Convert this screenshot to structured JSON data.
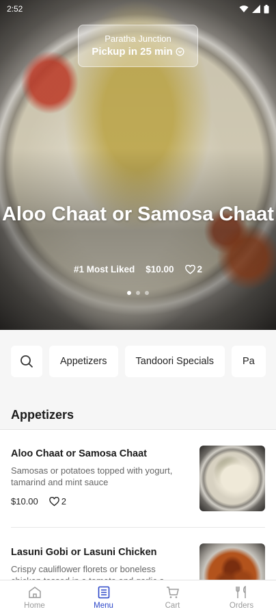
{
  "status_bar": {
    "time": "2:52"
  },
  "hero": {
    "store_name": "Paratha Junction",
    "pickup_text": "Pickup in 25 min",
    "title": "Aloo Chaat or Samosa Chaat",
    "badge": "#1 Most Liked",
    "price": "$10.00",
    "likes": "2",
    "carousel_pages": 3,
    "carousel_active": 1
  },
  "categories": [
    "Appetizers",
    "Tandoori Specials",
    "Pa"
  ],
  "section": {
    "title": "Appetizers"
  },
  "items": [
    {
      "name": "Aloo Chaat or Samosa Chaat",
      "description": "Samosas or potatoes topped with yogurt, tamarind and mint sauce",
      "price": "$10.00",
      "likes": "2"
    },
    {
      "name": "Lasuni Gobi or Lasuni Chicken",
      "description": "Crispy cauliflower florets or boneless chicken tossed in a tomato and garlic s..."
    }
  ],
  "nav": [
    {
      "label": "Home",
      "icon": "home-icon"
    },
    {
      "label": "Menu",
      "icon": "menu-icon",
      "active": true
    },
    {
      "label": "Cart",
      "icon": "cart-icon"
    },
    {
      "label": "Orders",
      "icon": "orders-icon"
    }
  ],
  "colors": {
    "accent": "#2a45c8",
    "muted": "#9a9a9a"
  }
}
